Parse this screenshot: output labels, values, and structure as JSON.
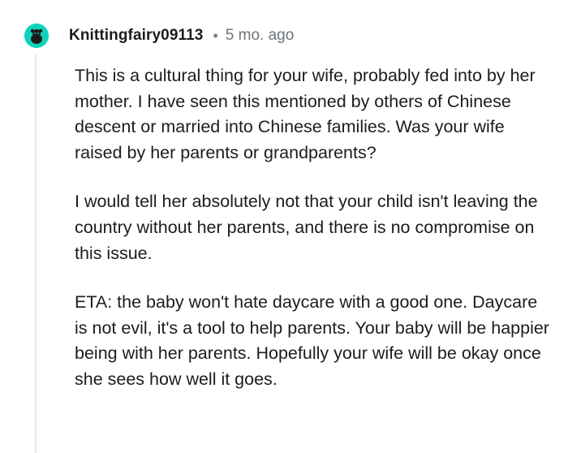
{
  "comment": {
    "author": "Knittingfairy09113",
    "separator": "•",
    "timestamp": "5 mo. ago",
    "avatar_color": "#0dd3bb",
    "avatar_icon": "snoo-avatar-icon",
    "paragraphs": [
      "This is a cultural thing for your wife, probably fed into by her mother. I have seen this mentioned by others of Chinese descent or married into Chinese families. Was your wife raised by her parents or grandparents?",
      "I would tell her absolutely not that your child isn't leaving the country without her parents, and there is no compromise on this issue.",
      "ETA: the baby won't hate daycare with a good one. Daycare is not evil, it's a tool to help parents. Your baby will be happier being with her parents. Hopefully your wife will be okay once she sees how well it goes."
    ]
  }
}
